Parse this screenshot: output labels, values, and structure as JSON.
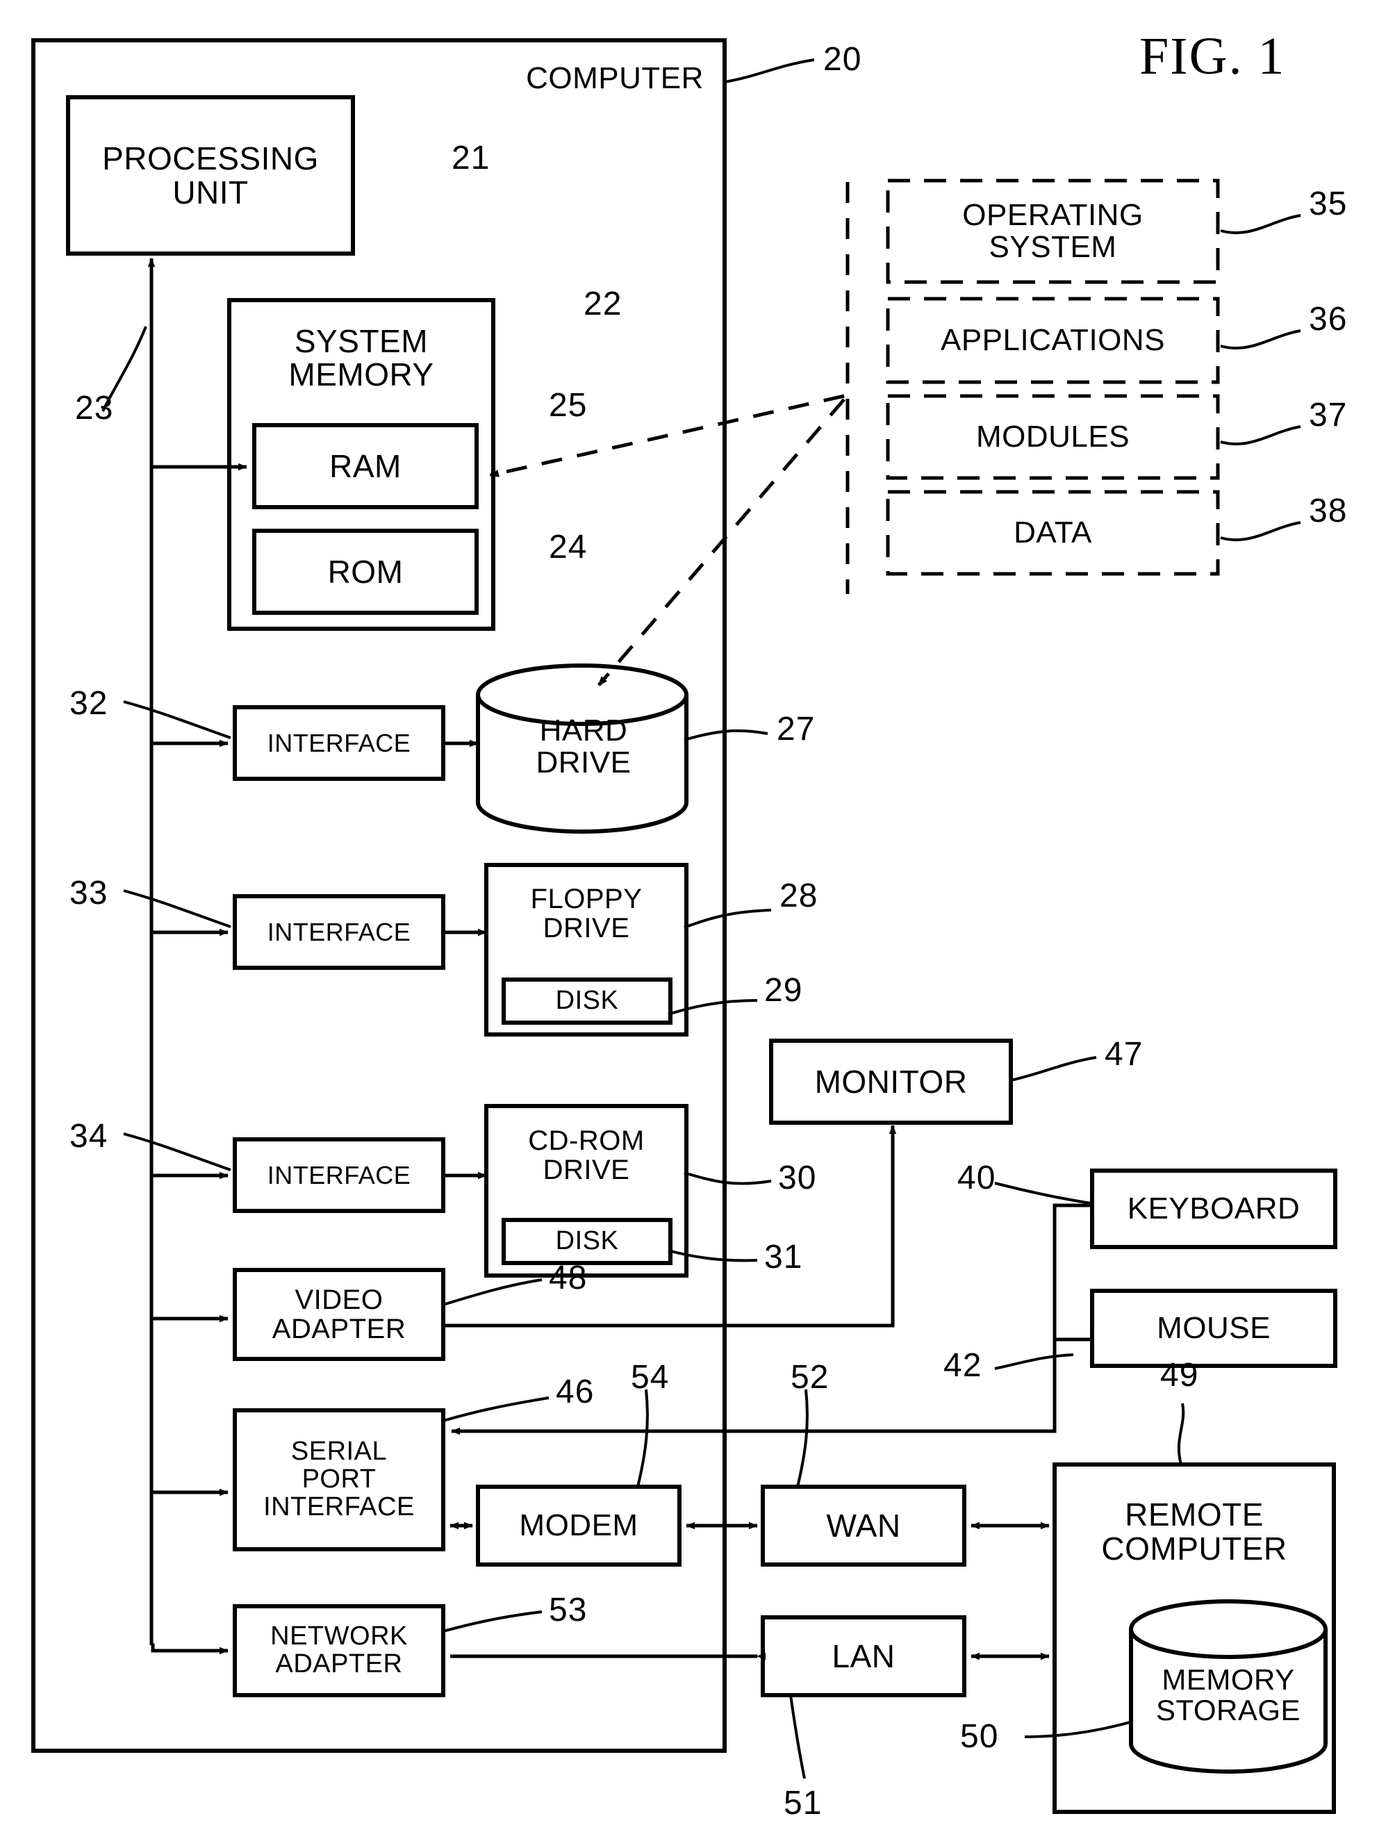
{
  "figure": {
    "title": "FIG. 1",
    "outer_label": "COMPUTER",
    "outer_ref": "20"
  },
  "blocks": {
    "processing_unit": {
      "label": "PROCESSING\nUNIT",
      "ref": "21"
    },
    "system_memory": {
      "label": "SYSTEM\nMEMORY",
      "ref": "22"
    },
    "ram": {
      "label": "RAM",
      "ref": "25"
    },
    "rom": {
      "label": "ROM",
      "ref": "24"
    },
    "bus": {
      "ref": "23"
    },
    "interface_hdd": {
      "label": "INTERFACE",
      "ref": "32"
    },
    "hard_drive": {
      "label": "HARD\nDRIVE",
      "ref": "27"
    },
    "interface_floppy": {
      "label": "INTERFACE",
      "ref": "33"
    },
    "floppy_drive": {
      "label": "FLOPPY\nDRIVE",
      "ref": "28"
    },
    "floppy_disk": {
      "label": "DISK",
      "ref": "29"
    },
    "interface_cdrom": {
      "label": "INTERFACE",
      "ref": "34"
    },
    "cdrom_drive": {
      "label": "CD-ROM\nDRIVE",
      "ref": "30"
    },
    "cdrom_disk": {
      "label": "DISK",
      "ref": "31"
    },
    "video_adapter": {
      "label": "VIDEO\nADAPTER",
      "ref": "48"
    },
    "monitor": {
      "label": "MONITOR",
      "ref": "47"
    },
    "keyboard": {
      "label": "KEYBOARD",
      "ref": "40"
    },
    "mouse": {
      "label": "MOUSE",
      "ref": "42"
    },
    "serial_port_interface": {
      "label": "SERIAL\nPORT\nINTERFACE",
      "ref": "46"
    },
    "modem": {
      "label": "MODEM",
      "ref": "54"
    },
    "wan": {
      "label": "WAN",
      "ref": "52"
    },
    "network_adapter": {
      "label": "NETWORK\nADAPTER",
      "ref": "53"
    },
    "lan": {
      "label": "LAN",
      "ref": "51"
    },
    "remote_computer": {
      "label": "REMOTE\nCOMPUTER",
      "ref": "49"
    },
    "memory_storage": {
      "label": "MEMORY\nSTORAGE",
      "ref": "50"
    }
  },
  "software_modules": [
    {
      "label": "OPERATING\nSYSTEM",
      "ref": "35"
    },
    {
      "label": "APPLICATIONS",
      "ref": "36"
    },
    {
      "label": "MODULES",
      "ref": "37"
    },
    {
      "label": "DATA",
      "ref": "38"
    }
  ],
  "colors": {
    "ink": "#000000",
    "paper": "#ffffff"
  }
}
